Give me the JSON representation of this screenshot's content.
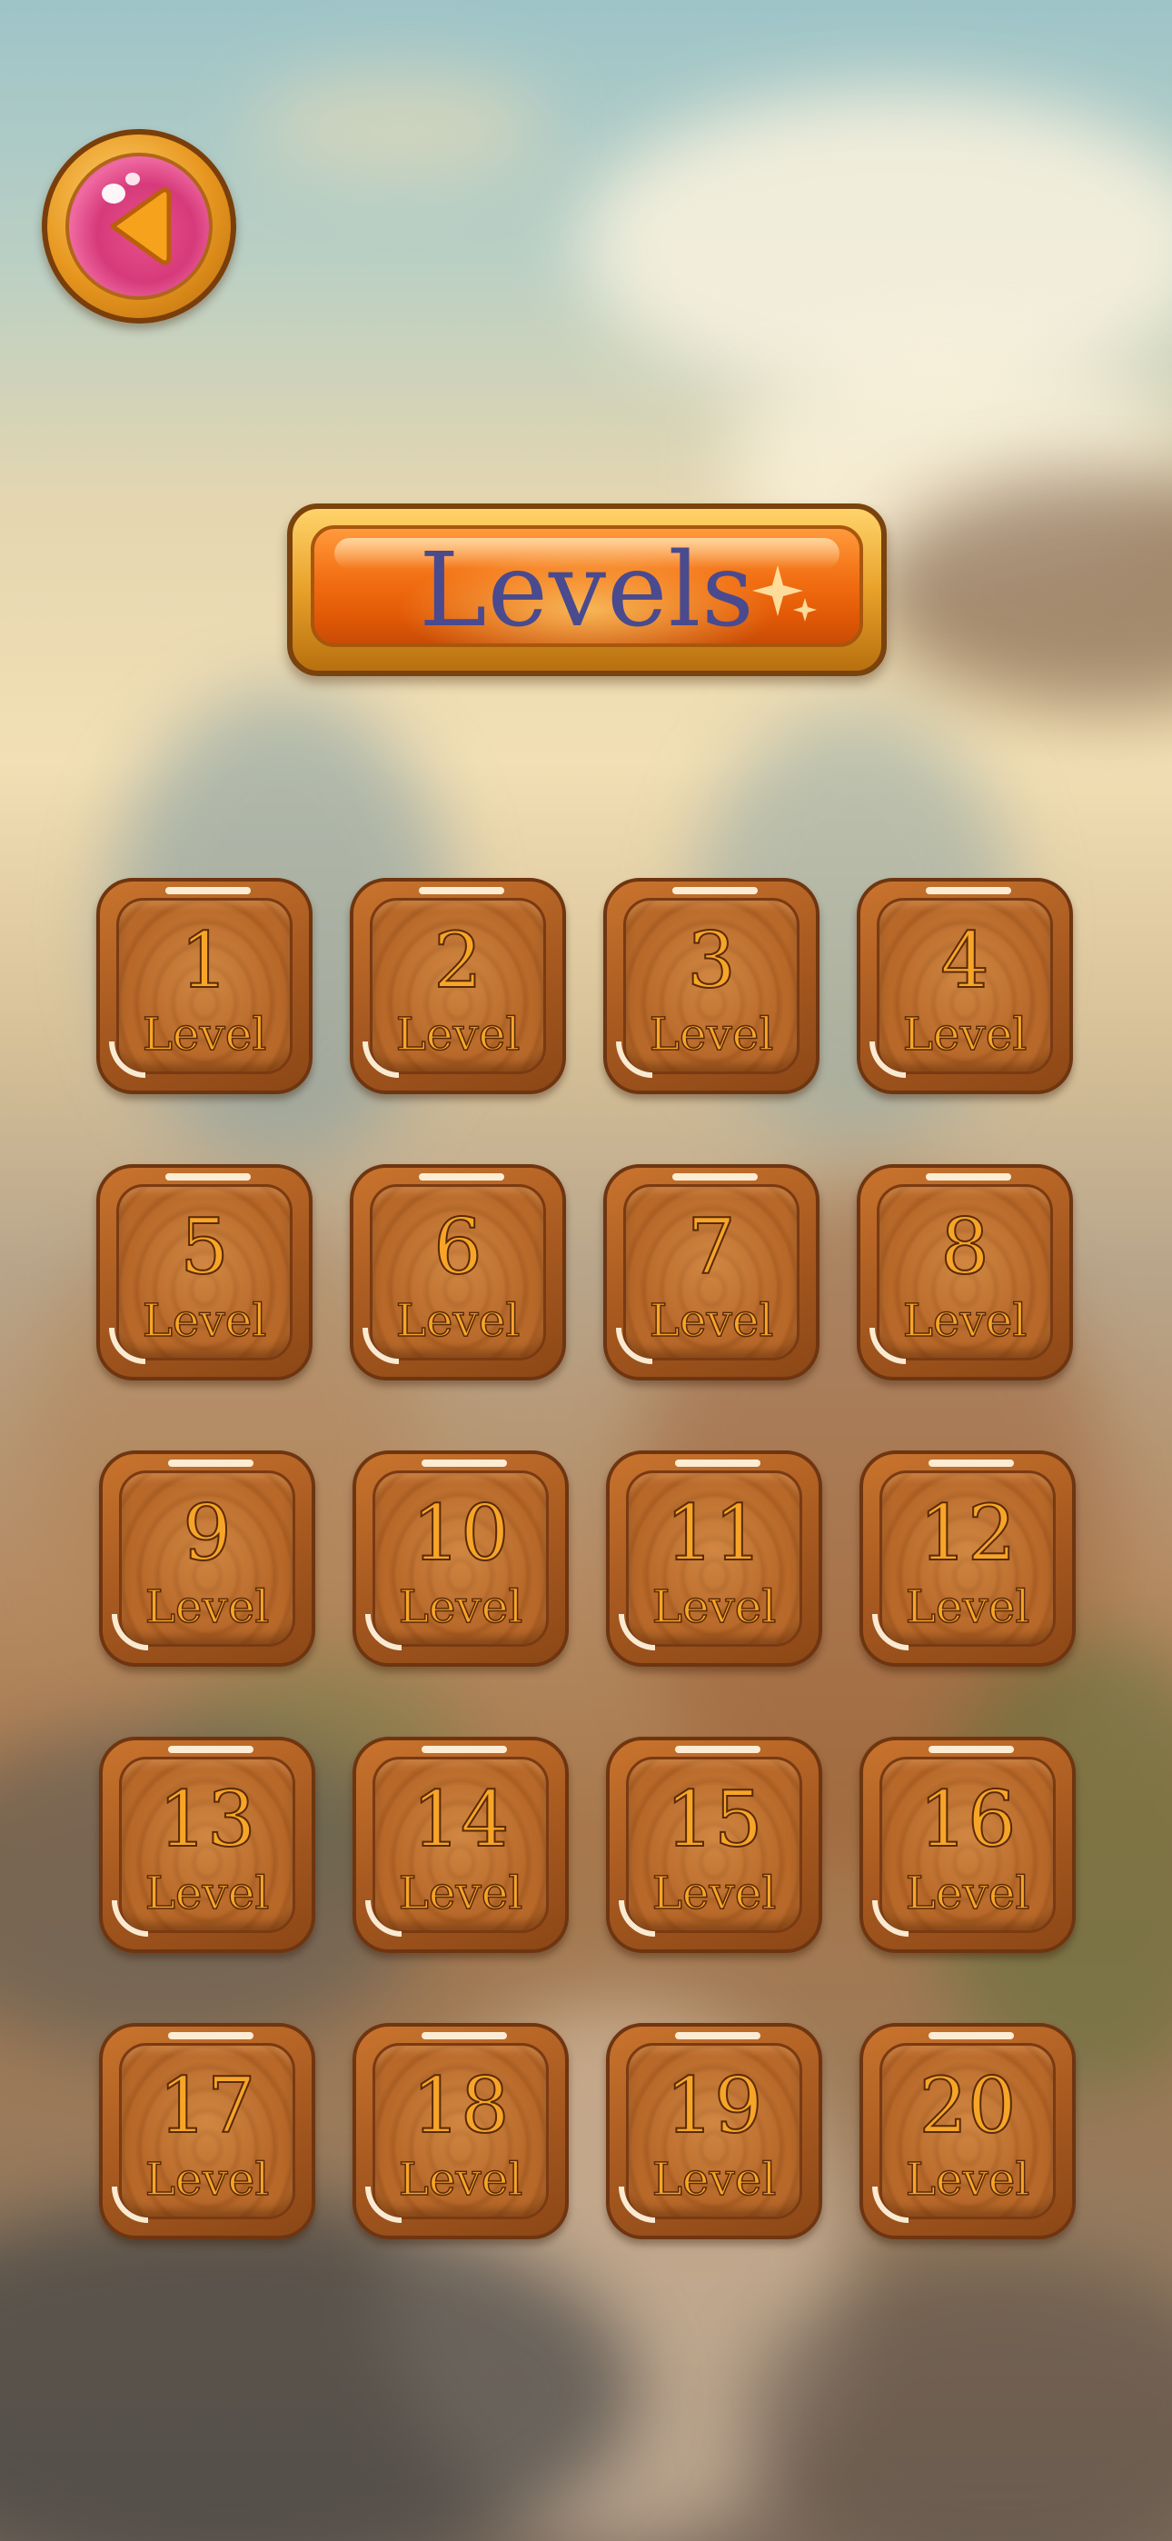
{
  "screen": {
    "title": "Levels",
    "back_button": {
      "icon": "back-arrow-icon"
    }
  },
  "levels": [
    {
      "number": "1",
      "label": "Level"
    },
    {
      "number": "2",
      "label": "Level"
    },
    {
      "number": "3",
      "label": "Level"
    },
    {
      "number": "4",
      "label": "Level"
    },
    {
      "number": "5",
      "label": "Level"
    },
    {
      "number": "6",
      "label": "Level"
    },
    {
      "number": "7",
      "label": "Level"
    },
    {
      "number": "8",
      "label": "Level"
    },
    {
      "number": "9",
      "label": "Level"
    },
    {
      "number": "10",
      "label": "Level"
    },
    {
      "number": "11",
      "label": "Level"
    },
    {
      "number": "12",
      "label": "Level"
    },
    {
      "number": "13",
      "label": "Level"
    },
    {
      "number": "14",
      "label": "Level"
    },
    {
      "number": "15",
      "label": "Level"
    },
    {
      "number": "16",
      "label": "Level"
    },
    {
      "number": "17",
      "label": "Level"
    },
    {
      "number": "18",
      "label": "Level"
    },
    {
      "number": "19",
      "label": "Level"
    },
    {
      "number": "20",
      "label": "Level"
    }
  ],
  "colors": {
    "title_text": "#4a4a8e",
    "level_text": "#f7a528",
    "tile_wood": "#a85a20",
    "back_button_fill": "#d63a7a",
    "banner_fill": "#f26e12"
  }
}
